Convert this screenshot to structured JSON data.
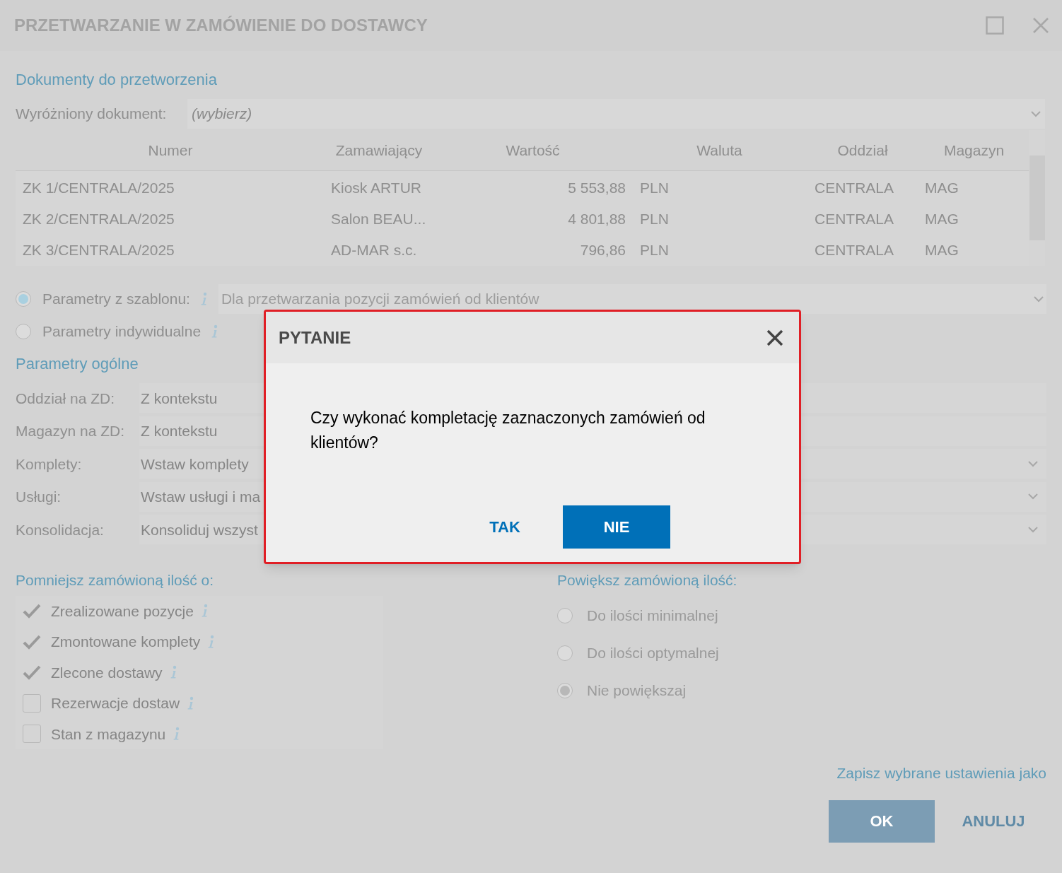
{
  "window": {
    "title": "PRZETWARZANIE W ZAMÓWIENIE DO DOSTAWCY"
  },
  "documents": {
    "section": "Dokumenty do przetworzenia",
    "highlighted_label": "Wyróżniony dokument:",
    "highlighted_placeholder": "(wybierz)",
    "table": {
      "columns": [
        "Numer",
        "Zamawiający",
        "Wartość",
        "Waluta",
        "Oddział",
        "Magazyn"
      ],
      "rows": [
        [
          "ZK 1/CENTRALA/2025",
          "Kiosk ARTUR",
          "5 553,88",
          "PLN",
          "CENTRALA",
          "MAG"
        ],
        [
          "ZK 2/CENTRALA/2025",
          "Salon BEAU...",
          "4 801,88",
          "PLN",
          "CENTRALA",
          "MAG"
        ],
        [
          "ZK 3/CENTRALA/2025",
          "AD-MAR s.c.",
          "796,86",
          "PLN",
          "CENTRALA",
          "MAG"
        ]
      ]
    }
  },
  "parameter_modes": [
    {
      "label": "Parametry z szablonu:",
      "selected": true,
      "value": "Dla przetwarzania pozycji zamówień od klientów"
    },
    {
      "label": "Parametry indywidualne",
      "selected": false
    }
  ],
  "general": {
    "section": "Parametry ogólne",
    "fields": [
      {
        "label": "Oddział na ZD:",
        "value": "Z kontekstu",
        "kind": "text"
      },
      {
        "label": "Magazyn na ZD:",
        "value": "Z kontekstu",
        "kind": "text"
      },
      {
        "label": "Komplety:",
        "value": "Wstaw komplety",
        "kind": "select"
      },
      {
        "label": "Usługi:",
        "value": "Wstaw usługi i ma",
        "kind": "select"
      },
      {
        "label": "Konsolidacja:",
        "value": "Konsoliduj wszyst",
        "kind": "select"
      }
    ]
  },
  "reduce": {
    "section": "Pomniejsz zamówioną ilość o:",
    "items": [
      {
        "label": "Zrealizowane pozycje",
        "checked": true
      },
      {
        "label": "Zmontowane komplety",
        "checked": true
      },
      {
        "label": "Zlecone dostawy",
        "checked": true
      },
      {
        "label": "Rezerwacje dostaw",
        "checked": false
      },
      {
        "label": "Stan z magazynu",
        "checked": false
      }
    ]
  },
  "increase": {
    "section": "Powiększ zamówioną ilość:",
    "options": [
      {
        "label": "Do ilości minimalnej",
        "selected": false
      },
      {
        "label": "Do ilości optymalnej",
        "selected": false
      },
      {
        "label": "Nie powiększaj",
        "selected": true
      }
    ]
  },
  "save_link": "Zapisz wybrane ustawienia jako",
  "buttons": [
    "OK",
    "ANULUJ"
  ],
  "dialog": {
    "title": "PYTANIE",
    "message": "Czy wykonać kompletację zaznaczonych zamówień od klientów?",
    "buttons": [
      {
        "label": "TAK",
        "primary": false
      },
      {
        "label": "NIE",
        "primary": true
      }
    ]
  }
}
